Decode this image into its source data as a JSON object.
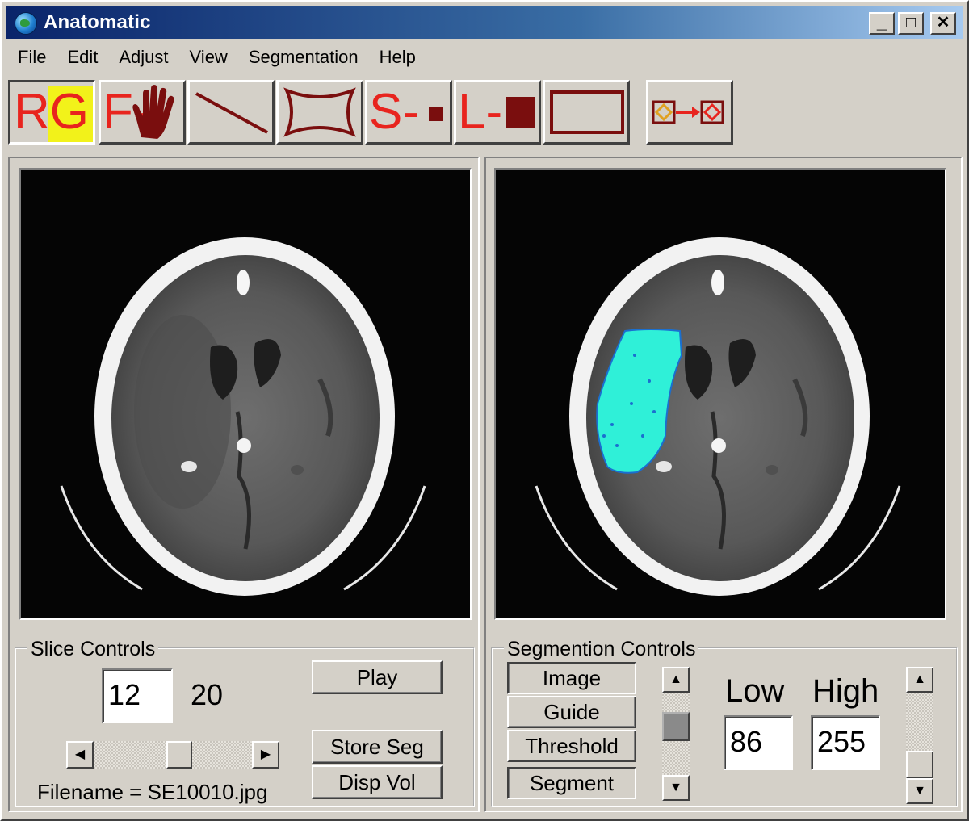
{
  "window": {
    "title": "Anatomatic",
    "controls": {
      "minimize": "_",
      "maximize": "□",
      "close": "✕"
    }
  },
  "menu": [
    "File",
    "Edit",
    "Adjust",
    "View",
    "Segmentation",
    "Help"
  ],
  "toolbar": {
    "region_grow_label": "RG",
    "free_hand_label": "F-",
    "small_brush_label": "S-",
    "large_brush_label": "L-",
    "icons": [
      "region-grow-icon",
      "free-hand-icon",
      "line-icon",
      "curve-shape-icon",
      "small-brush-icon",
      "large-brush-icon",
      "rectangle-icon",
      "copy-region-icon"
    ],
    "accent_color": "#e8241e",
    "dark_accent": "#7a0e0e",
    "pressed_highlight": "#f2f21a"
  },
  "slice_controls": {
    "title": "Slice Controls",
    "current_slice": "12",
    "total_slices": "20",
    "slider_fraction": 0.55,
    "play_label": "Play",
    "store_seg_label": "Store Seg",
    "disp_vol_label": "Disp Vol",
    "filename_text": "Filename = SE10010.jpg"
  },
  "segmentation_controls": {
    "title": "Segmention Controls",
    "buttons": [
      "Image",
      "Guide",
      "Threshold",
      "Segment"
    ],
    "low_label": "Low",
    "high_label": "High",
    "low_value": "86",
    "high_value": "255",
    "segment_color": "#2ff0d8"
  }
}
